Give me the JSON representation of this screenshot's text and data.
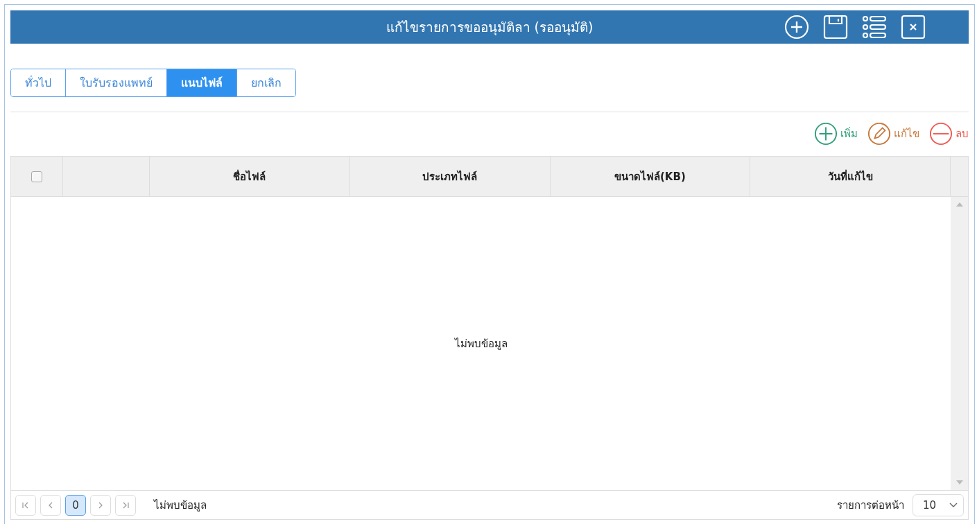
{
  "window": {
    "title": "แก้ไขรายการขออนุมัติลา (รออนุมัติ)"
  },
  "tabs": [
    {
      "label": "ทั่วไป",
      "selected": false
    },
    {
      "label": "ใบรับรองแพทย์",
      "selected": false
    },
    {
      "label": "แนบไฟล์",
      "selected": true
    },
    {
      "label": "ยกเลิก",
      "selected": false
    }
  ],
  "toolbar": [
    {
      "kind": "add",
      "label": "เพิ่ม",
      "color": "#2e9e7a"
    },
    {
      "kind": "edit",
      "label": "แก้ไข",
      "color": "#c8773a"
    },
    {
      "kind": "delete",
      "label": "ลบ",
      "color": "#f0584f"
    }
  ],
  "table": {
    "select_all": {
      "checked": false
    },
    "columns": [
      "ชื่อไฟล์",
      "ประเภทไฟล์",
      "ขนาดไฟล์(KB)",
      "วันที่แก้ไข"
    ],
    "empty_message": "ไม่พบข้อมูล"
  },
  "pager": {
    "page": "0",
    "status": "ไม่พบข้อมูล",
    "page_size_label": "รายการต่อหน้า",
    "page_size": "10"
  }
}
